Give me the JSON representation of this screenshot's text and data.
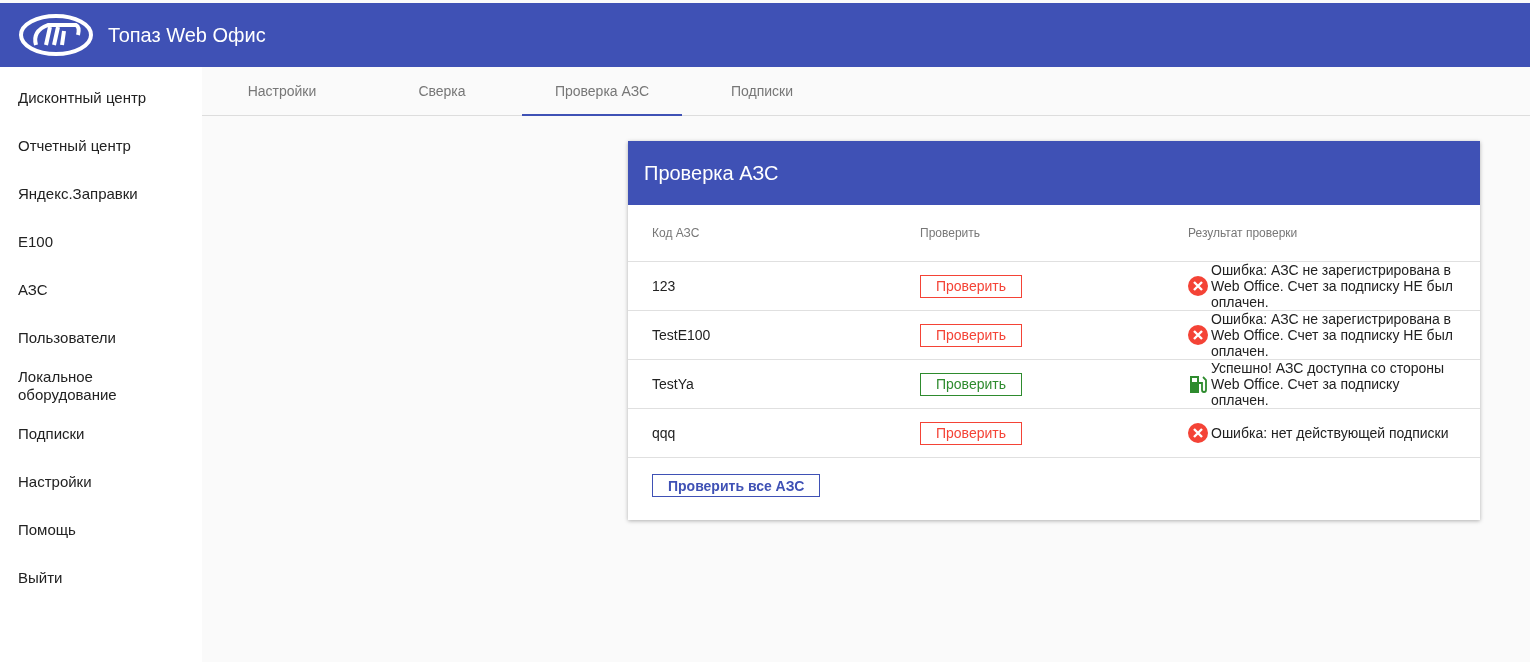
{
  "app": {
    "title": "Топаз Web Офис"
  },
  "sidebar": {
    "items": [
      {
        "label": "Дисконтный центр"
      },
      {
        "label": "Отчетный центр"
      },
      {
        "label": "Яндекс.Заправки"
      },
      {
        "label": "E100"
      },
      {
        "label": "АЗС"
      },
      {
        "label": "Пользователи"
      },
      {
        "label": "Локальное оборудование"
      },
      {
        "label": "Подписки"
      },
      {
        "label": "Настройки"
      },
      {
        "label": "Помощь"
      },
      {
        "label": "Выйти"
      }
    ]
  },
  "tabs": [
    {
      "label": "Настройки",
      "selected": false
    },
    {
      "label": "Сверка",
      "selected": false
    },
    {
      "label": "Проверка АЗС",
      "selected": true
    },
    {
      "label": "Подписки",
      "selected": false
    }
  ],
  "card": {
    "title": "Проверка АЗС",
    "columns": [
      "Код АЗС",
      "Проверить",
      "Результат проверки"
    ],
    "rows": [
      {
        "code": "123",
        "button": "Проверить",
        "success": false,
        "result": "Ошибка: АЗС не зарегистрирована в Web Office. Счет за подписку НЕ был оплачен."
      },
      {
        "code": "TestE100",
        "button": "Проверить",
        "success": false,
        "result": "Ошибка: АЗС не зарегистрирована в Web Office. Счет за подписку НЕ был оплачен."
      },
      {
        "code": "TestYa",
        "button": "Проверить",
        "success": true,
        "result": "Успешно! АЗС доступна со стороны Web Office. Счет за подписку оплачен."
      },
      {
        "code": "qqq",
        "button": "Проверить",
        "success": false,
        "result": "Ошибка: нет действующей подписки"
      }
    ],
    "check_all_button": "Проверить все АЗС"
  }
}
